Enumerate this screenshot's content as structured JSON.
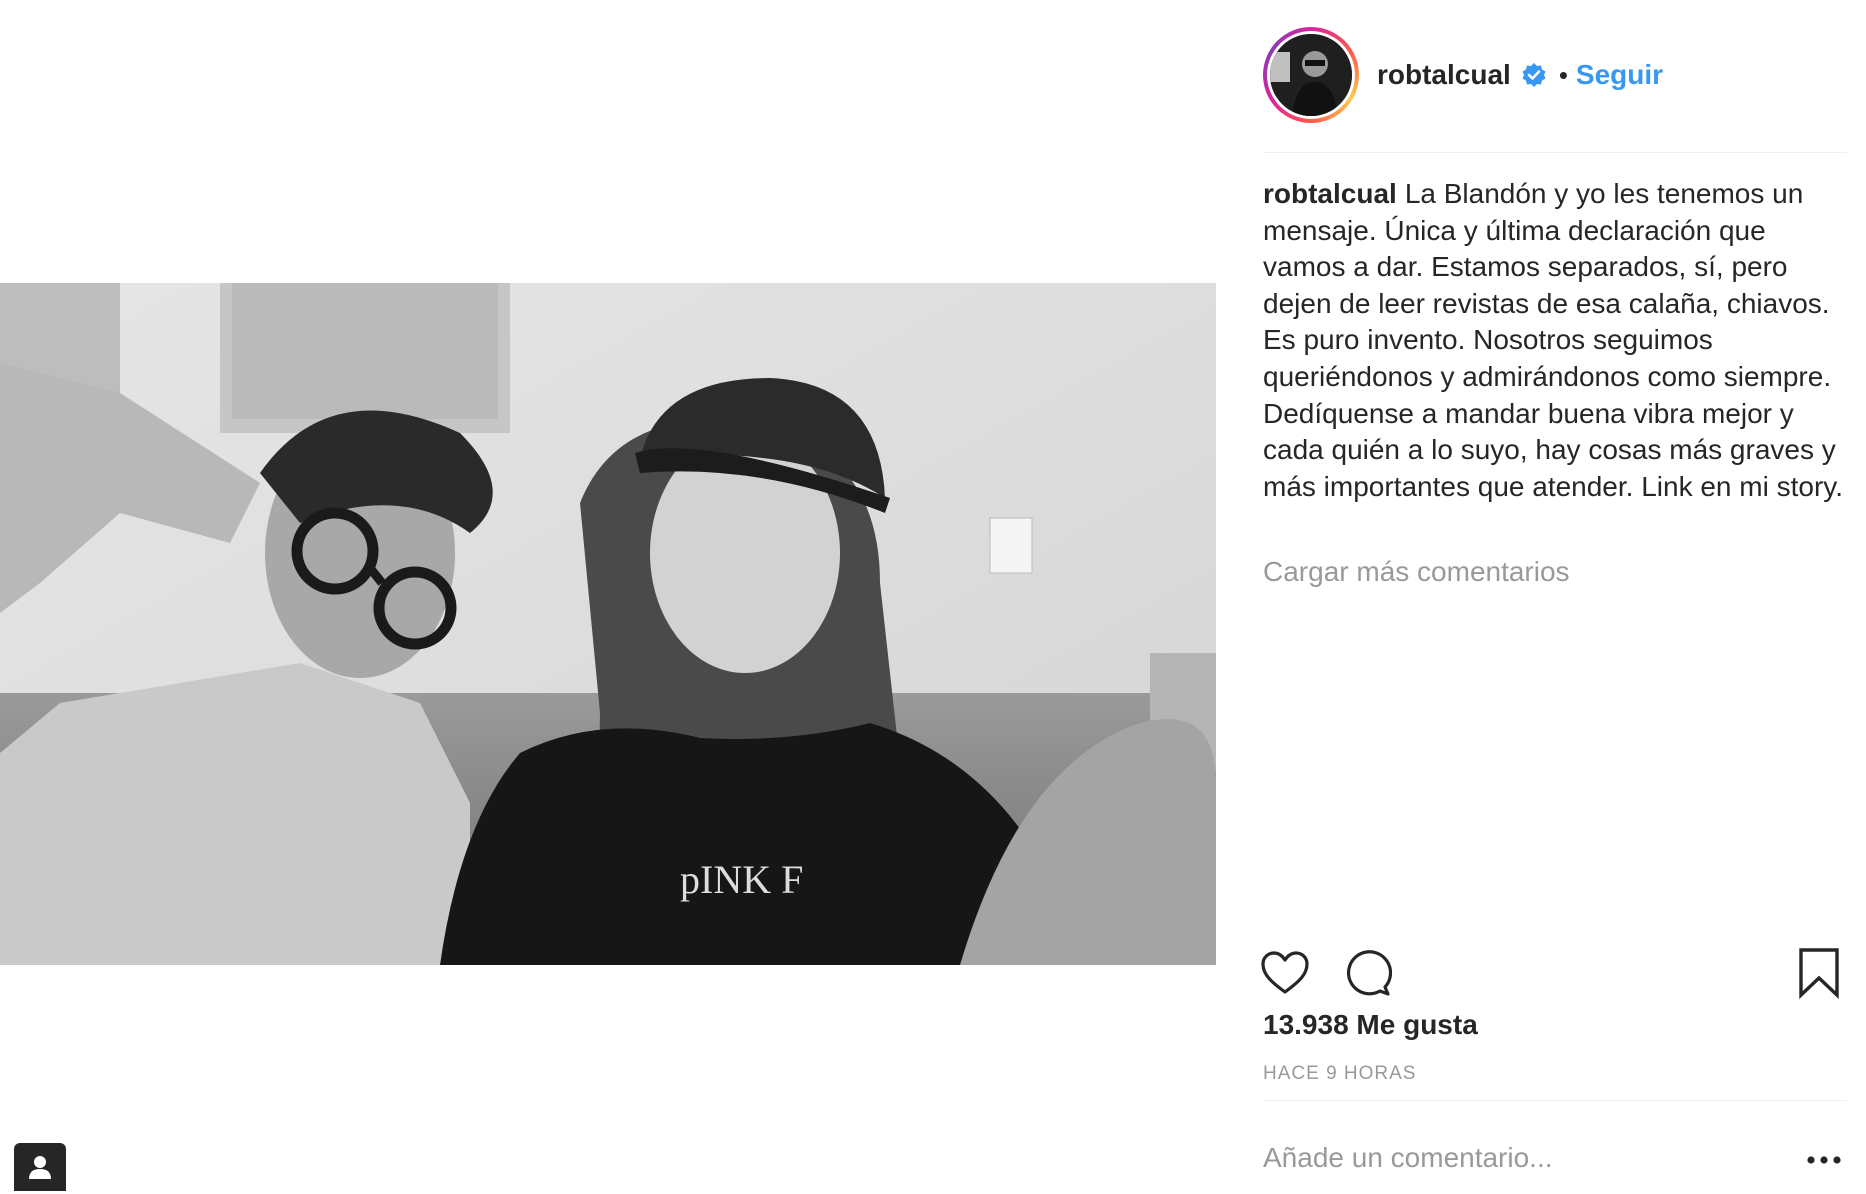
{
  "post": {
    "username": "robtalcual",
    "verified": true,
    "separator": "•",
    "follow_label": "Seguir",
    "caption_user": "robtalcual",
    "caption_text": "La Blandón y yo les tenemos un mensaje. Única y última declaración que vamos a dar. Estamos separados, sí, pero dejen de leer revistas de esa calaña, chiavos. Es puro invento. Nosotros seguimos queriéndonos y admirándonos como siempre. Dedíquense a mandar buena vibra mejor y cada quién a lo suyo, hay cosas más graves y más importantes que atender. Link en mi story.",
    "load_more_label": "Cargar más comentarios",
    "likes_label": "13.938 Me gusta",
    "timestamp": "HACE 9 HORAS",
    "comment_placeholder": "Añade un comentario..."
  },
  "icons": {
    "like": "heart-icon",
    "comment": "comment-bubble-icon",
    "save": "bookmark-icon",
    "more": "ellipsis-icon",
    "tag_people": "person-icon",
    "verified": "verified-badge-icon"
  },
  "colors": {
    "link_blue": "#3897f0",
    "muted_gray": "#999999",
    "text": "#262626",
    "divider": "#efefef"
  }
}
